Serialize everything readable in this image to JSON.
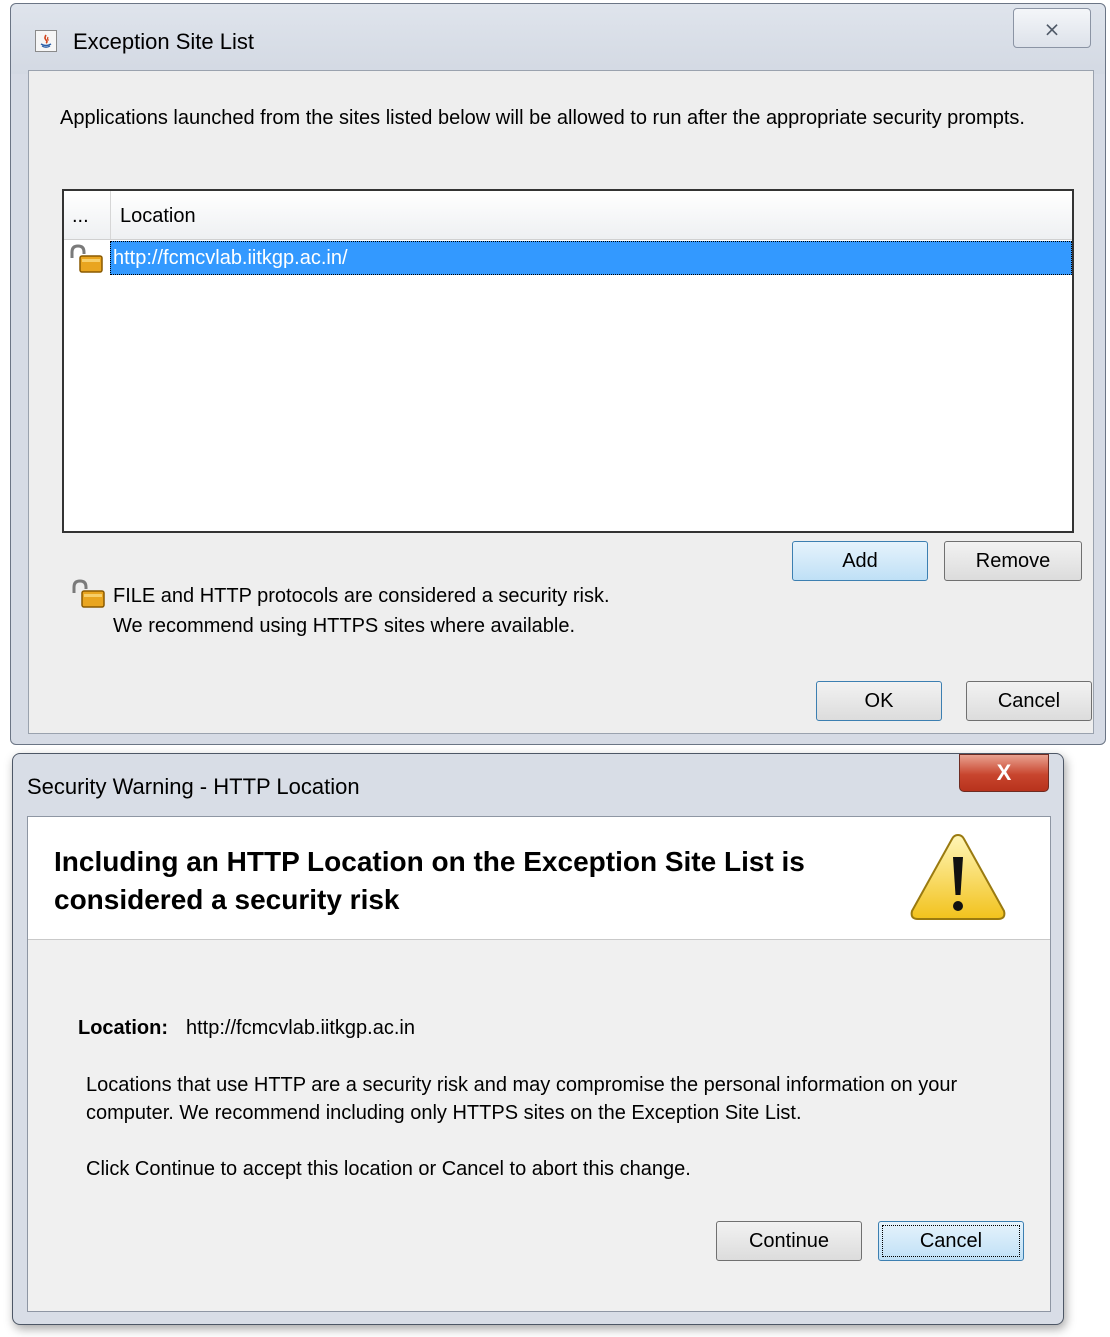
{
  "exception_dialog": {
    "title": "Exception Site List",
    "close_symbol": "⨯",
    "intro": "Applications launched from the sites listed below will be allowed to run after the appropriate security prompts.",
    "table": {
      "columns": [
        "...",
        "Location"
      ],
      "rows": [
        {
          "location": "http://fcmcvlab.iitkgp.ac.in/",
          "selected": true
        }
      ]
    },
    "add_label": "Add",
    "remove_label": "Remove",
    "risk_note_line1": "FILE and HTTP protocols are considered a security risk.",
    "risk_note_line2": "We recommend using HTTPS sites where available.",
    "ok_label": "OK",
    "cancel_label": "Cancel"
  },
  "security_warning": {
    "title": "Security Warning - HTTP Location",
    "close_symbol": "X",
    "headline": "Including an HTTP Location on the Exception Site List is considered a security risk",
    "location_label": "Location:",
    "location_value": "http://fcmcvlab.iitkgp.ac.in",
    "paragraph1": "Locations that use HTTP are a security risk and may compromise the personal information on your computer.  We recommend including only HTTPS sites on the Exception Site List.",
    "paragraph2": "Click Continue to accept this location or Cancel to abort this change.",
    "continue_label": "Continue",
    "cancel_label": "Cancel"
  },
  "colors": {
    "selection": "#3399ff",
    "default_button": "#bfe0f6",
    "close_button_red": "#c8452e",
    "warning_yellow": "#f7d23a"
  },
  "icons": [
    "java-icon",
    "unlocked-padlock-icon",
    "warning-triangle-icon",
    "close-icon"
  ]
}
